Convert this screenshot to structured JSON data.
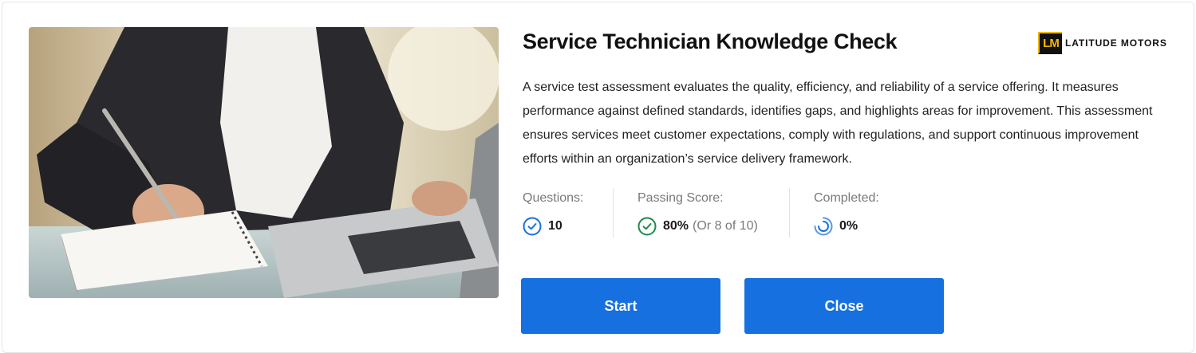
{
  "assessment": {
    "title": "Service Technician Knowledge Check",
    "description": "A service test assessment evaluates the quality, efficiency, and reliability of a service offering. It measures performance against defined standards, identifies gaps, and highlights areas for improvement. This assessment ensures services meet customer expectations, comply with regulations, and support continuous improvement efforts within an organization’s service delivery framework.",
    "image_alt": "Person writing in a notebook beside a laptop"
  },
  "brand": {
    "logo_mark": "LM",
    "name": "LATITUDE MOTORS",
    "accent_color": "#f2b705"
  },
  "stats": {
    "questions": {
      "label": "Questions:",
      "value": "10",
      "icon": "check-circle-icon",
      "color": "#1670e0"
    },
    "passing": {
      "label": "Passing Score:",
      "value": "80%",
      "detail": "(Or 8 of 10)",
      "icon": "check-circle-icon",
      "color": "#1e8a4c"
    },
    "completed": {
      "label": "Completed:",
      "value": "0%",
      "progress": 0,
      "icon": "progress-ring-icon",
      "color": "#1670e0"
    }
  },
  "actions": {
    "start_label": "Start",
    "close_label": "Close",
    "button_color": "#1670e0"
  }
}
